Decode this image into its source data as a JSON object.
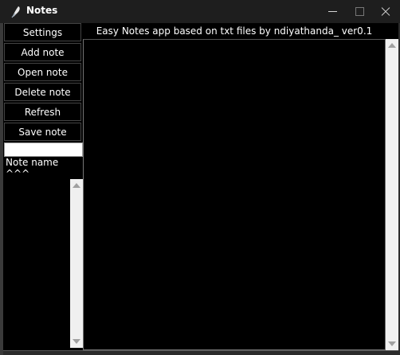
{
  "window": {
    "title": "Notes"
  },
  "sidebar": {
    "buttons": [
      {
        "label": "Settings"
      },
      {
        "label": "Add note"
      },
      {
        "label": "Open note"
      },
      {
        "label": "Delete note"
      },
      {
        "label": "Refresh"
      },
      {
        "label": "Save note"
      }
    ],
    "name_input": {
      "value": "",
      "placeholder": ""
    },
    "name_label": "Note name ^^^"
  },
  "main": {
    "header": "Easy Notes app based on txt files by ndiyathanda_ ver0.1"
  },
  "icons": {
    "app": "feather-pen-icon",
    "minimize": "minimize-icon",
    "maximize": "maximize-icon",
    "close": "close-icon"
  },
  "colors": {
    "background": "#000000",
    "titlebar": "#1e1e1e",
    "text": "#ffffff",
    "scrollbar": "#f0f0f0"
  }
}
